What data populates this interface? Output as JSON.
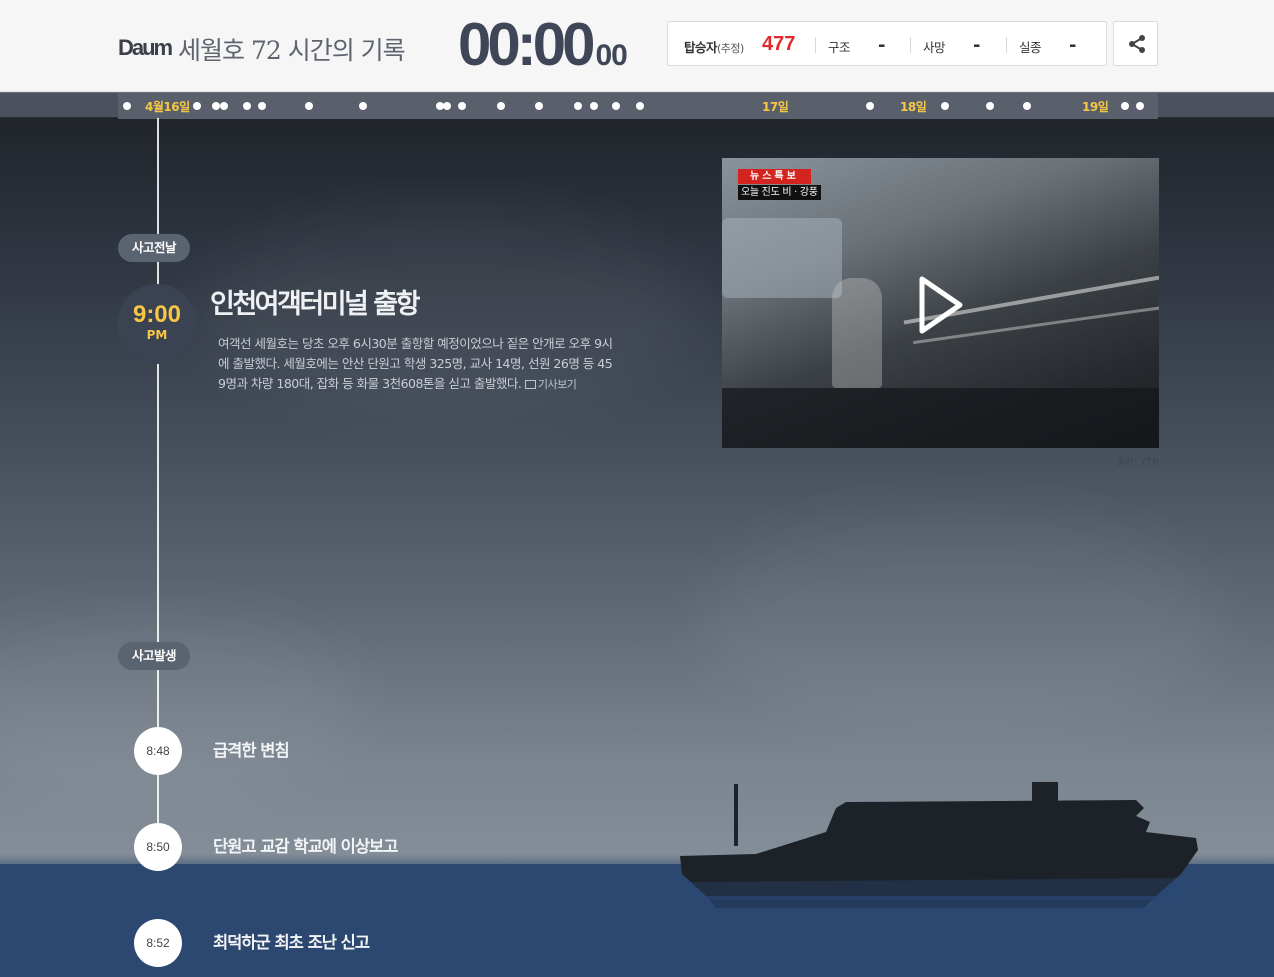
{
  "header": {
    "logo": "Daum",
    "title": "세월호 72 시간의 기록",
    "clock": {
      "main": "00:00",
      "sub": "00"
    },
    "stats": [
      {
        "label": "탑승자",
        "note": "(추정)",
        "value": "477"
      },
      {
        "label": "구조",
        "value": "-"
      },
      {
        "label": "사망",
        "value": "-"
      },
      {
        "label": "실종",
        "value": "-"
      }
    ],
    "share_icon": "share-icon"
  },
  "timebar": {
    "labels": [
      {
        "text": "4월16일"
      },
      {
        "text": "17일"
      },
      {
        "text": "18일"
      },
      {
        "text": "19일"
      }
    ]
  },
  "timeline": {
    "phase1": "사고전날",
    "event1": {
      "time": "9:00",
      "ampm": "PM",
      "title": "인천여객터미널 출항",
      "body": "여객선 세월호는 당초 오후 6시30분 출항할 예정이었으나 짙은 안개로 오후 9시에 출발했다. 세월호에는 안산 단원고 학생 325명, 교사 14명, 선원 26명 등 459명과 차량 180대, 잡화 등 화물 3천608톤을 싣고 출발했다.",
      "link": "기사보기"
    },
    "video": {
      "tag": "뉴스특보",
      "subtitle": "오늘 진도 비 · 강풍",
      "source": "출처: YTN",
      "icon": "play-icon"
    },
    "phase2": "사고발생",
    "events": [
      {
        "time": "8:48",
        "title": "급격한 변침"
      },
      {
        "time": "8:50",
        "title": "단원고 교감 학교에 이상보고"
      },
      {
        "time": "8:52",
        "title": "최덕하군 최초 조난 신고"
      }
    ]
  }
}
